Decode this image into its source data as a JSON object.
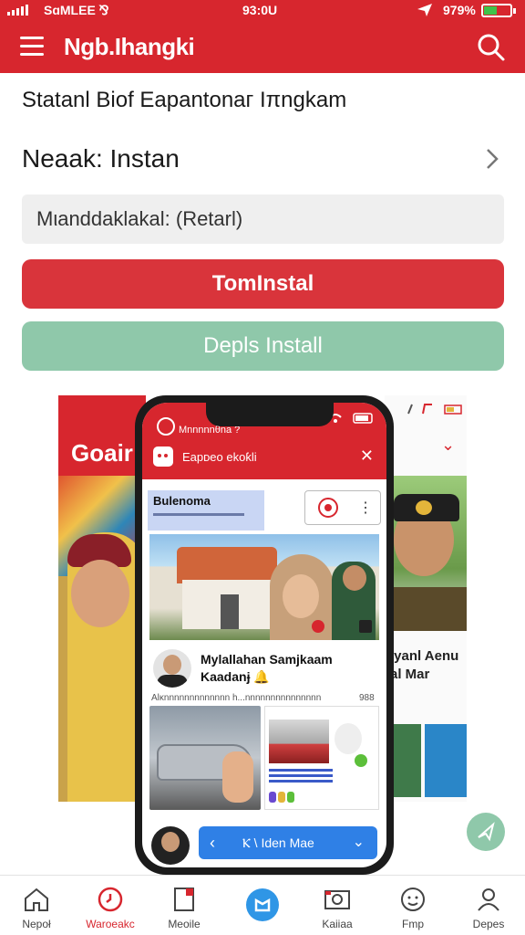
{
  "status_bar": {
    "carrier": "SɑMLEE ⅋",
    "time": "93:0U",
    "battery_pct": "979%"
  },
  "app_bar": {
    "title": "Ngb.Ihangki"
  },
  "content": {
    "subtitle": "Statanl Biof Eapantonaг Iπngkam",
    "mode_label": "Neaak: Instan",
    "select_value": "Mιanddaklakal: (Retarl)",
    "primary_button": "TomInstal",
    "secondary_button": "Depls Install"
  },
  "preview": {
    "left_card_title": "Goair",
    "right_card_text": "ιyanl Aenu\n͆al Mar",
    "phone": {
      "status_text": "Mnnnnnθna ?",
      "header_name": "Eapᴅeo ekoƙli",
      "close": "✕",
      "tag_label": "Bulenoma",
      "headline": "Mylallahan Samjkaam Kaadanɉ 🔔",
      "sub_meta": "Alκnnnnnnnnnnnnn h...nnnnnnnnnnnnnnn",
      "count": "988",
      "bottom_pill_text": "Ⲕ \\ Iden Mae"
    }
  },
  "bottom_nav": {
    "tabs": [
      {
        "label": "Nepoł",
        "icon": "home-icon"
      },
      {
        "label": "Waroeakc",
        "icon": "clock-icon",
        "active": true
      },
      {
        "label": "Meoile",
        "icon": "document-icon"
      },
      {
        "label": "",
        "icon": "center-action-icon"
      },
      {
        "label": "Kaiiaa",
        "icon": "photo-icon"
      },
      {
        "label": "Fmp",
        "icon": "face-icon"
      },
      {
        "label": "Depes",
        "icon": "profile-icon"
      }
    ]
  },
  "colors": {
    "brand_red": "#d7262e",
    "secondary_green": "#8fc8aa",
    "accent_blue": "#2f80e6"
  }
}
